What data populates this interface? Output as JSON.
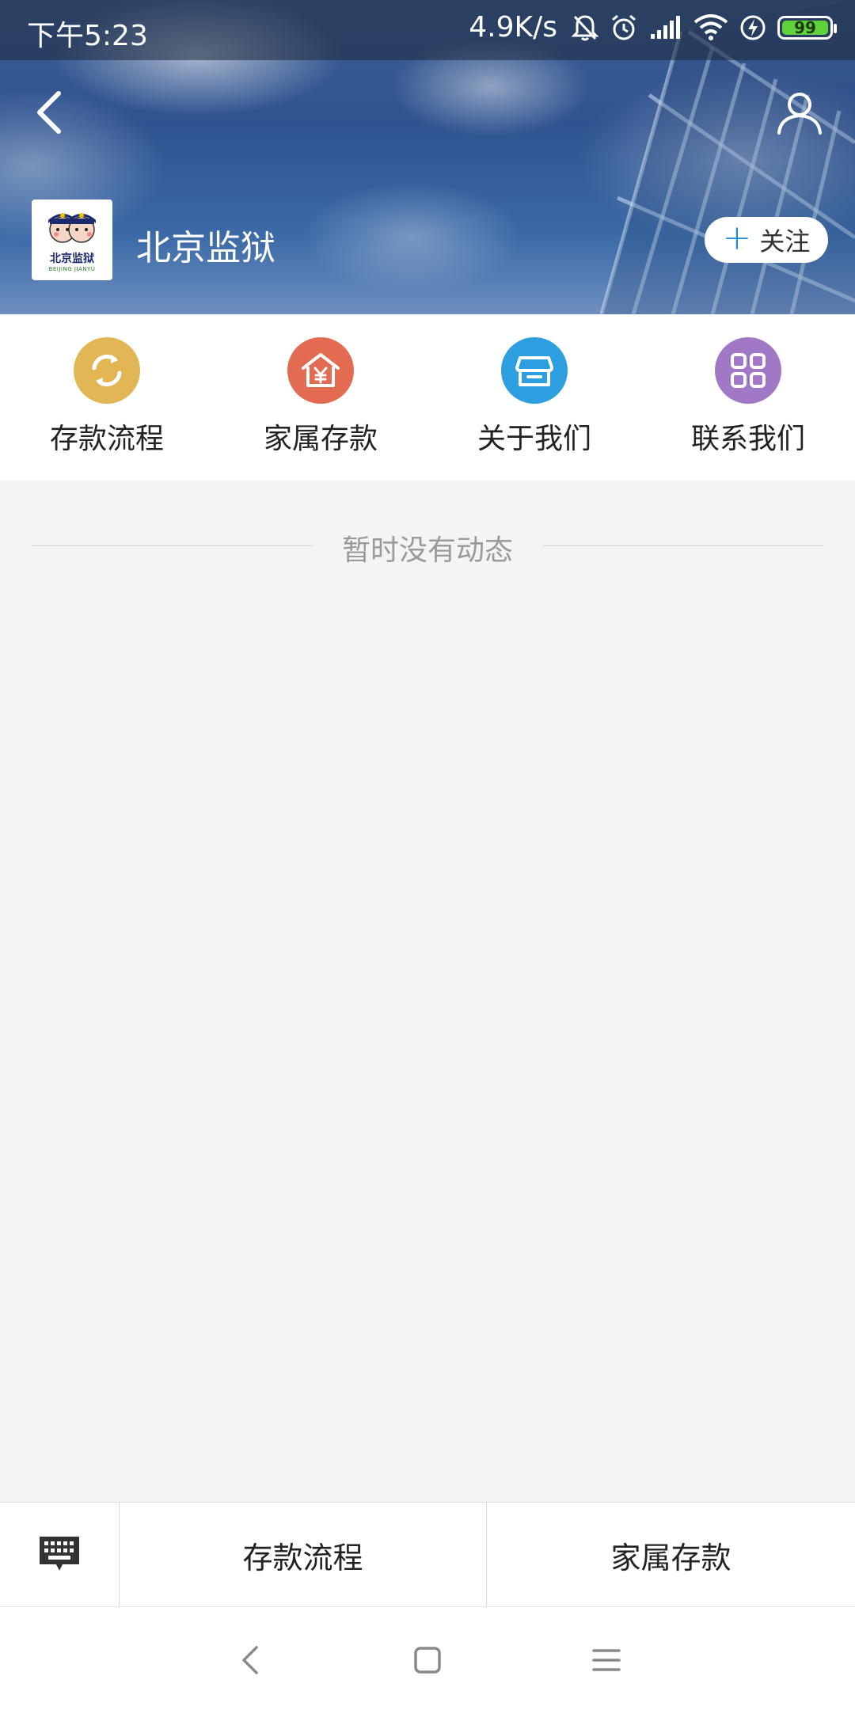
{
  "status_bar": {
    "time": "下午5:23",
    "network_speed": "4.9K/s",
    "battery": "99",
    "icons": [
      "bell-off-icon",
      "alarm-icon",
      "signal-icon",
      "wifi-icon",
      "charging-icon",
      "battery-icon"
    ]
  },
  "header": {
    "title": "北京监狱",
    "logo_text": "北京监狱",
    "logo_subtext": "BEIJING JIANYU",
    "follow_label": "关注"
  },
  "quick_menu": [
    {
      "label": "存款流程",
      "icon": "cycle-icon",
      "color": "#e2b655"
    },
    {
      "label": "家属存款",
      "icon": "yen-house-icon",
      "color": "#e26b52"
    },
    {
      "label": "关于我们",
      "icon": "store-icon",
      "color": "#2d9ee0"
    },
    {
      "label": "联系我们",
      "icon": "grid-icon",
      "color": "#a078c6"
    }
  ],
  "feed": {
    "empty_text": "暂时没有动态"
  },
  "bottom_bar": {
    "keyboard_icon": "keyboard-icon",
    "button_1": "存款流程",
    "button_2": "家属存款"
  },
  "colors": {
    "accent": "#1e8bdc",
    "background": "#f4f4f4"
  }
}
